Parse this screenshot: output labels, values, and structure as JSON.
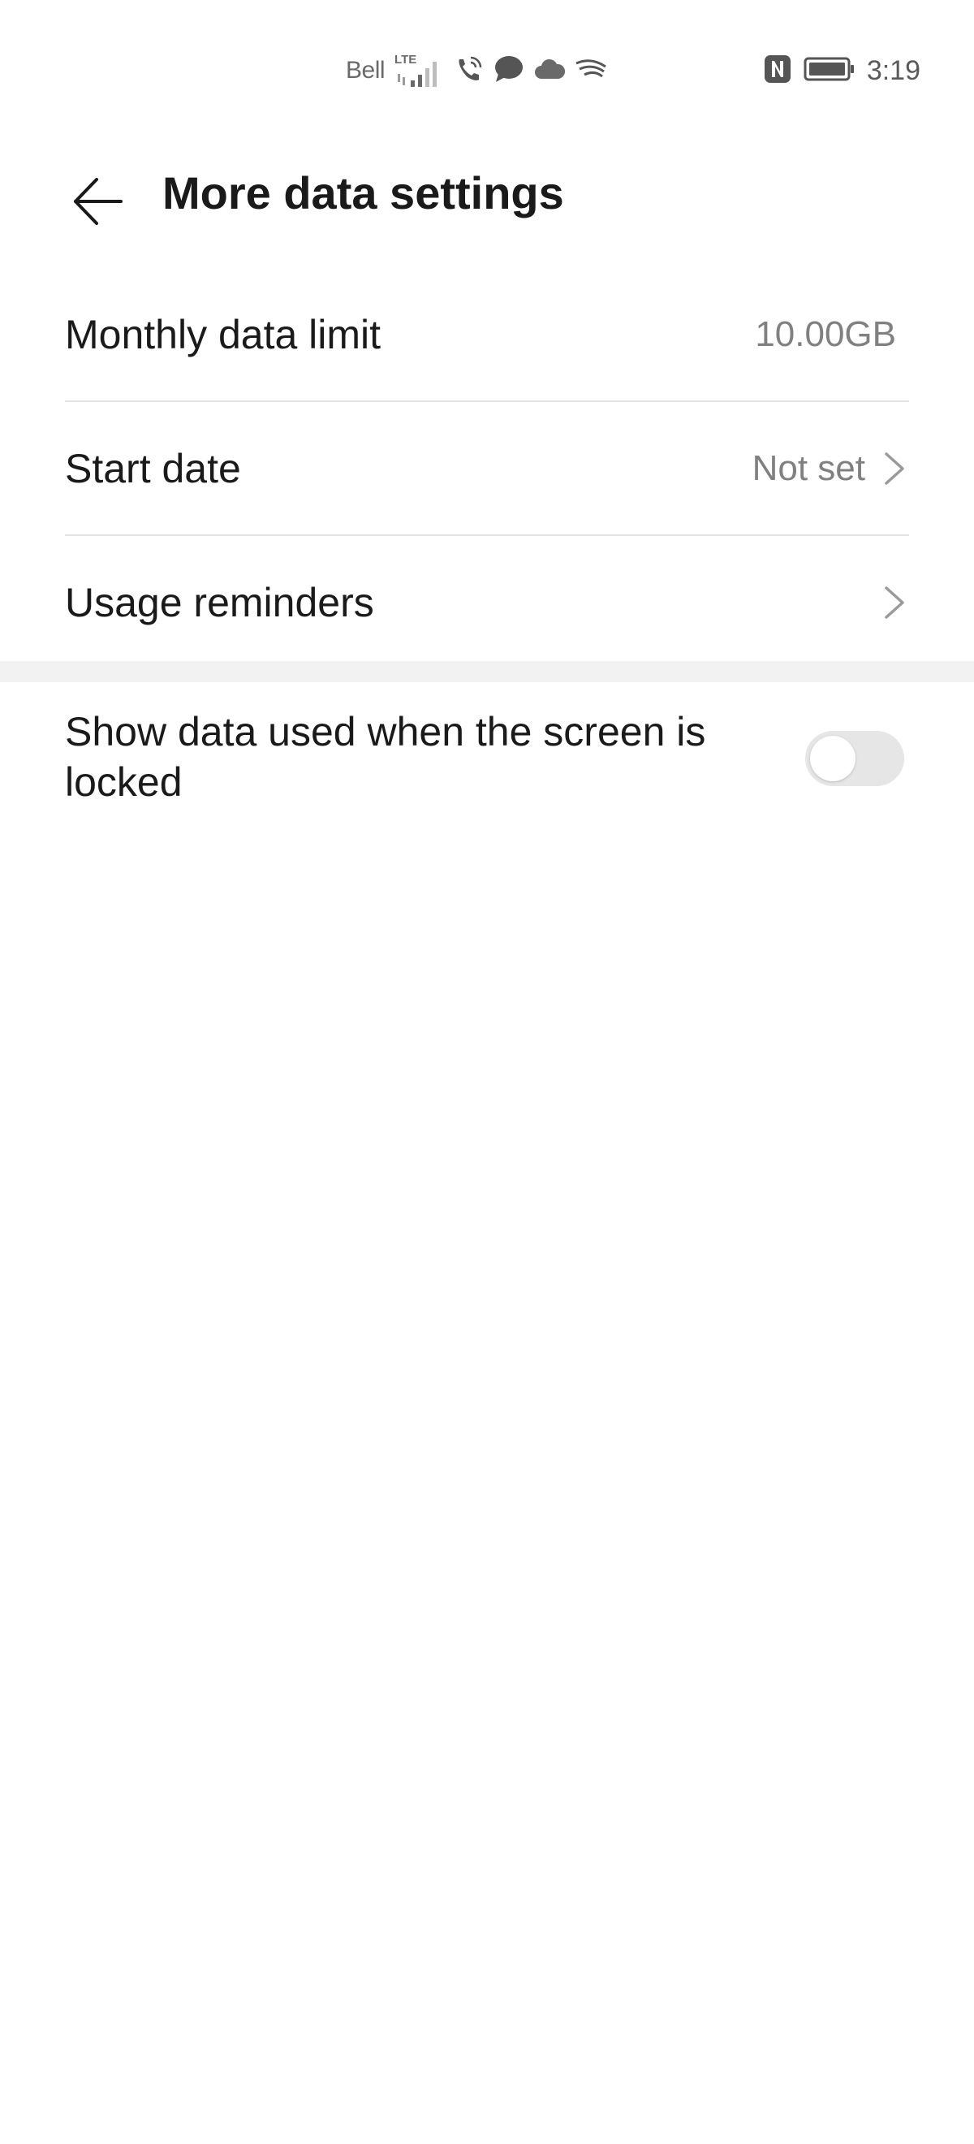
{
  "status_bar": {
    "carrier": "Bell",
    "network": "LTE",
    "time": "3:19",
    "icons": [
      "signal-icon",
      "wifi-calling-icon",
      "message-icon",
      "cloud-icon",
      "swiftkey-icon",
      "nfc-icon",
      "battery-icon"
    ]
  },
  "header": {
    "title": "More data settings",
    "back_icon": "back-arrow-icon"
  },
  "settings": {
    "monthly_limit": {
      "label": "Monthly data limit",
      "value": "10.00GB"
    },
    "start_date": {
      "label": "Start date",
      "value": "Not set"
    },
    "usage_reminders": {
      "label": "Usage reminders"
    },
    "lock_screen_data": {
      "label": "Show data used when the screen is locked",
      "enabled": false
    }
  },
  "colors": {
    "text_primary": "#1a1a1a",
    "text_secondary": "#808080",
    "divider": "#e3e3e3",
    "section_gap": "#f2f2f2",
    "switch_off": "#e6e6e6"
  }
}
